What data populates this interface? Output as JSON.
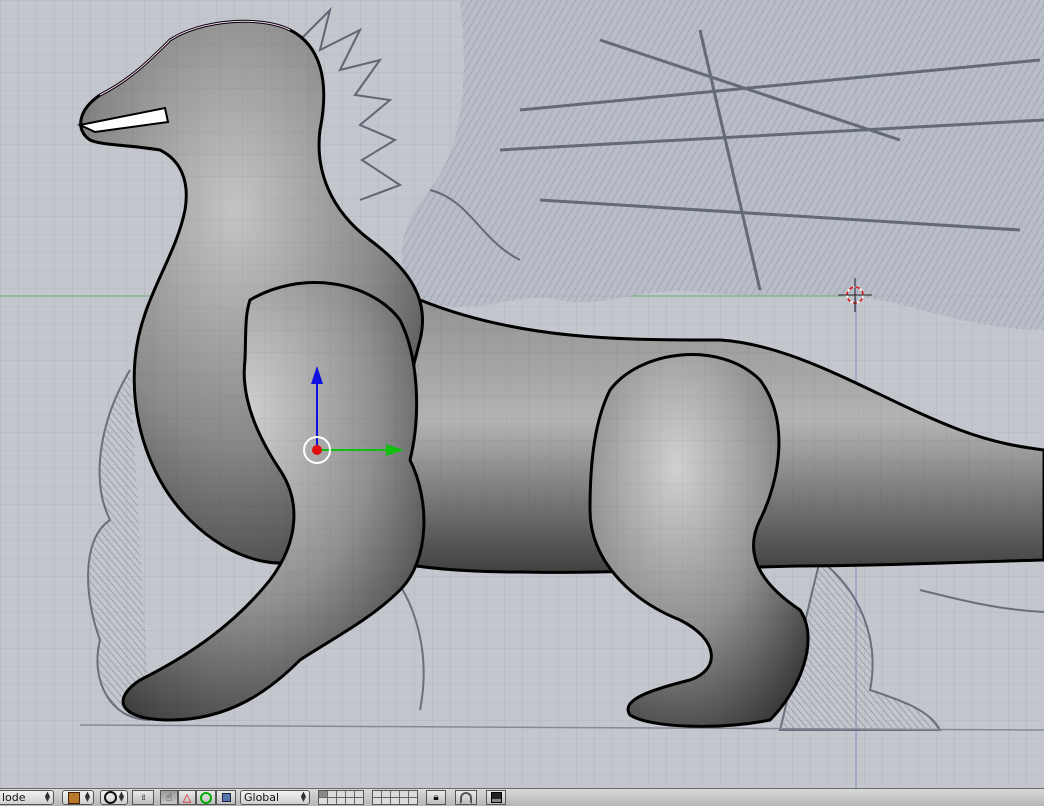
{
  "viewport": {
    "name": "3D View",
    "background_image": "dragon pencil sketch reference",
    "object": "dragon base mesh",
    "manipulator": "translate widget"
  },
  "toolbar": {
    "mode_label": "lode",
    "orientation_label": "Global",
    "icons": {
      "mode_updown": "updown-arrows-icon",
      "viewport_shading": "cube-shading-icon",
      "pivot": "pivot-point-icon",
      "hand": "hand-manipulator-icon",
      "translate": "translate-triangle-icon",
      "rotate": "rotate-circle-icon",
      "scale": "scale-square-icon",
      "lock": "lock-icon",
      "snap": "magnet-icon",
      "render": "render-image-icon"
    }
  },
  "colors": {
    "toolbar_bg": "#c8c8c8",
    "grid": "#a8acb4",
    "axis_x": "#00d000",
    "axis_z": "#0010e0",
    "cursor_red": "#e01010"
  }
}
